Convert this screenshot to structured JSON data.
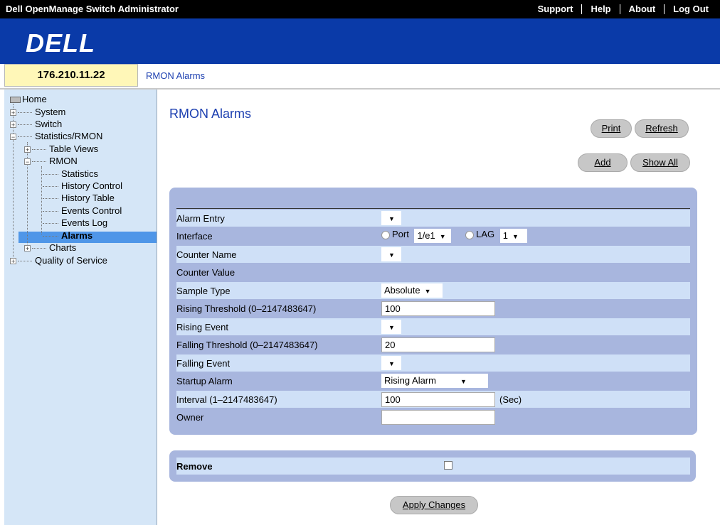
{
  "header": {
    "app_title": "Dell OpenManage Switch Administrator",
    "links": [
      "Support",
      "Help",
      "About",
      "Log Out"
    ]
  },
  "brand": {
    "logo": "DELL"
  },
  "ip": "176.210.11.22",
  "breadcrumb": "RMON Alarms",
  "tree": {
    "home": "Home",
    "system": "System",
    "switch": "Switch",
    "stats_rmon": "Statistics/RMON",
    "table_views": "Table Views",
    "rmon": "RMON",
    "statistics": "Statistics",
    "history_control": "History Control",
    "history_table": "History Table",
    "events_control": "Events Control",
    "events_log": "Events Log",
    "alarms": "Alarms",
    "charts": "Charts",
    "qos": "Quality of Service"
  },
  "page": {
    "title": "RMON Alarms",
    "buttons": {
      "print": "Print",
      "refresh": "Refresh",
      "add": "Add",
      "show_all": "Show All",
      "apply": "Apply Changes"
    }
  },
  "form": {
    "alarm_entry": {
      "label": "Alarm Entry",
      "value": ""
    },
    "interface": {
      "label": "Interface",
      "port_label": "Port",
      "port_value": "1/e1",
      "lag_label": "LAG",
      "lag_value": "1"
    },
    "counter_name": {
      "label": "Counter Name",
      "value": ""
    },
    "counter_value": {
      "label": "Counter Value"
    },
    "sample_type": {
      "label": "Sample Type",
      "value": "Absolute"
    },
    "rising_threshold": {
      "label": "Rising Threshold (0–2147483647)",
      "value": "100"
    },
    "rising_event": {
      "label": "Rising Event",
      "value": ""
    },
    "falling_threshold": {
      "label": "Falling Threshold (0–2147483647)",
      "value": "20"
    },
    "falling_event": {
      "label": "Falling Event",
      "value": ""
    },
    "startup_alarm": {
      "label": "Startup Alarm",
      "value": "Rising Alarm"
    },
    "interval": {
      "label": "Interval (1–2147483647)",
      "value": "100",
      "unit": "(Sec)"
    },
    "owner": {
      "label": "Owner",
      "value": ""
    },
    "remove": {
      "label": "Remove"
    }
  }
}
